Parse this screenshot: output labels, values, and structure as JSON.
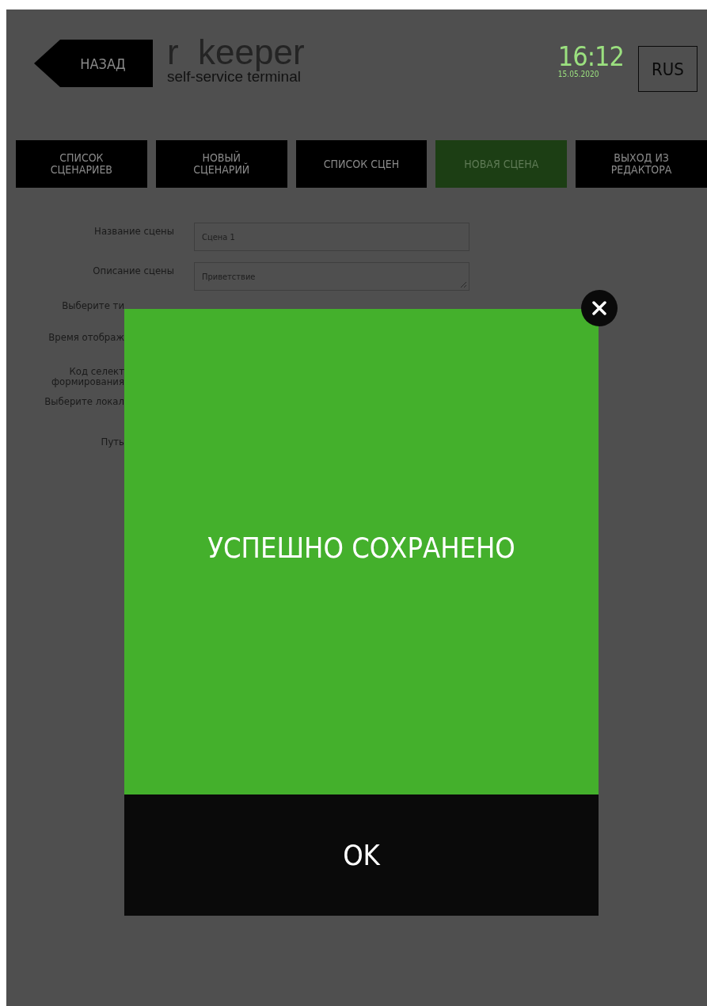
{
  "header": {
    "back_button": "НАЗАД",
    "logo": {
      "brand": "r  keeper",
      "subtitle": "self-service terminal"
    },
    "clock": {
      "time": "16:12",
      "date": "15.05.2020"
    },
    "language_button": "RUS"
  },
  "tabs": [
    {
      "label": "СПИСОК\nСЦЕНАРИЕВ",
      "selected": false
    },
    {
      "label": "НОВЫЙ\nСЦЕНАРИЙ",
      "selected": false
    },
    {
      "label": "СПИСОК СЦЕН",
      "selected": false
    },
    {
      "label": "НОВАЯ СЦЕНА",
      "selected": true
    },
    {
      "label": "ВЫХОД ИЗ\nРЕДАКТОРА",
      "selected": false
    }
  ],
  "form": {
    "fields": [
      {
        "label": "Название сцены",
        "value": "Сцена 1",
        "kind": "input"
      },
      {
        "label": "Описание сцены",
        "value": "Приветствие",
        "kind": "textarea"
      }
    ],
    "partial_labels": [
      "Выберите ти",
      "Время отображ",
      "Код селект\nформирования",
      "Выберите локал",
      "Путь"
    ]
  },
  "dialog": {
    "message": "УСПЕШНО СОХРАНЕНО",
    "ok_button": "OK"
  }
}
